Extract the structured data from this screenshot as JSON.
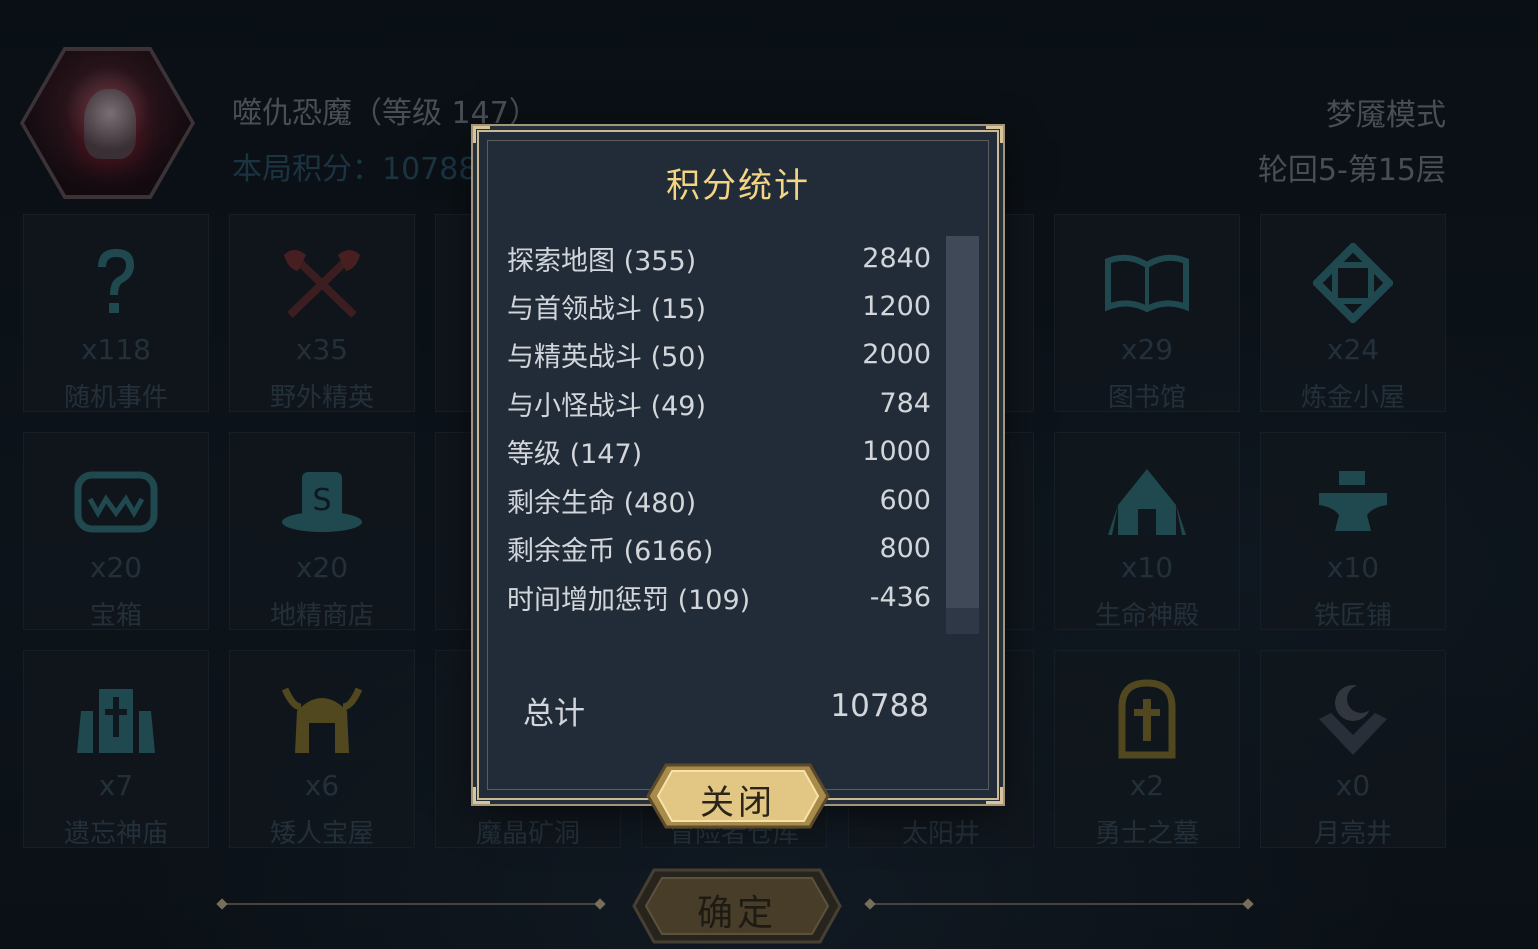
{
  "header": {
    "boss_name": "噬仇恐魔（等级 147）",
    "score_label": "本局积分：10788",
    "mode": "梦魇模式",
    "floor": "轮回5-第15层"
  },
  "tiles": [
    {
      "count": "x118",
      "label": "随机事件",
      "icon": "question-icon"
    },
    {
      "count": "x35",
      "label": "野外精英",
      "icon": "crossed-axes-icon"
    },
    {
      "count": "x29",
      "label": "图书馆",
      "icon": "open-book-icon"
    },
    {
      "count": "x24",
      "label": "炼金小屋",
      "icon": "alchemy-rune-icon"
    },
    {
      "count": "x20",
      "label": "宝箱",
      "icon": "chest-icon"
    },
    {
      "count": "x20",
      "label": "地精商店",
      "icon": "goblin-shop-hat-icon"
    },
    {
      "count": "x10",
      "label": "生命神殿",
      "icon": "life-temple-icon"
    },
    {
      "count": "x10",
      "label": "铁匠铺",
      "icon": "anvil-icon"
    },
    {
      "count": "x7",
      "label": "遗忘神庙",
      "icon": "forgotten-temple-icon"
    },
    {
      "count": "x6",
      "label": "矮人宝屋",
      "icon": "dwarf-helmet-icon"
    },
    {
      "count": "",
      "label": "魔晶矿洞",
      "icon": "crystal-mine-icon"
    },
    {
      "count": "",
      "label": "冒险者仓库",
      "icon": "warehouse-icon"
    },
    {
      "count": "",
      "label": "太阳井",
      "icon": "sun-well-icon"
    },
    {
      "count": "x2",
      "label": "勇士之墓",
      "icon": "tomb-icon"
    },
    {
      "count": "x0",
      "label": "月亮井",
      "icon": "moon-well-icon"
    }
  ],
  "modal": {
    "title": "积分统计",
    "rows": [
      {
        "label": "探索地图 (355)",
        "value": "2840"
      },
      {
        "label": "与首领战斗 (15)",
        "value": "1200"
      },
      {
        "label": "与精英战斗 (50)",
        "value": "2000"
      },
      {
        "label": "与小怪战斗 (49)",
        "value": "784"
      },
      {
        "label": "等级 (147)",
        "value": "1000"
      },
      {
        "label": "剩余生命 (480)",
        "value": "600"
      },
      {
        "label": "剩余金币 (6166)",
        "value": "800"
      },
      {
        "label": "时间增加惩罚 (109)",
        "value": "-436"
      }
    ],
    "total_label": "总计",
    "total_value": "10788",
    "close_label": "关闭"
  },
  "confirm_label": "确定",
  "colors": {
    "title_gold": "#f3d583",
    "button_gold": "#e2c784",
    "frame_gold": "#c9b994",
    "panel_bg": "#222c38",
    "teal_icon": "#2f6b72",
    "yellow_icon": "#7a6a2a"
  }
}
